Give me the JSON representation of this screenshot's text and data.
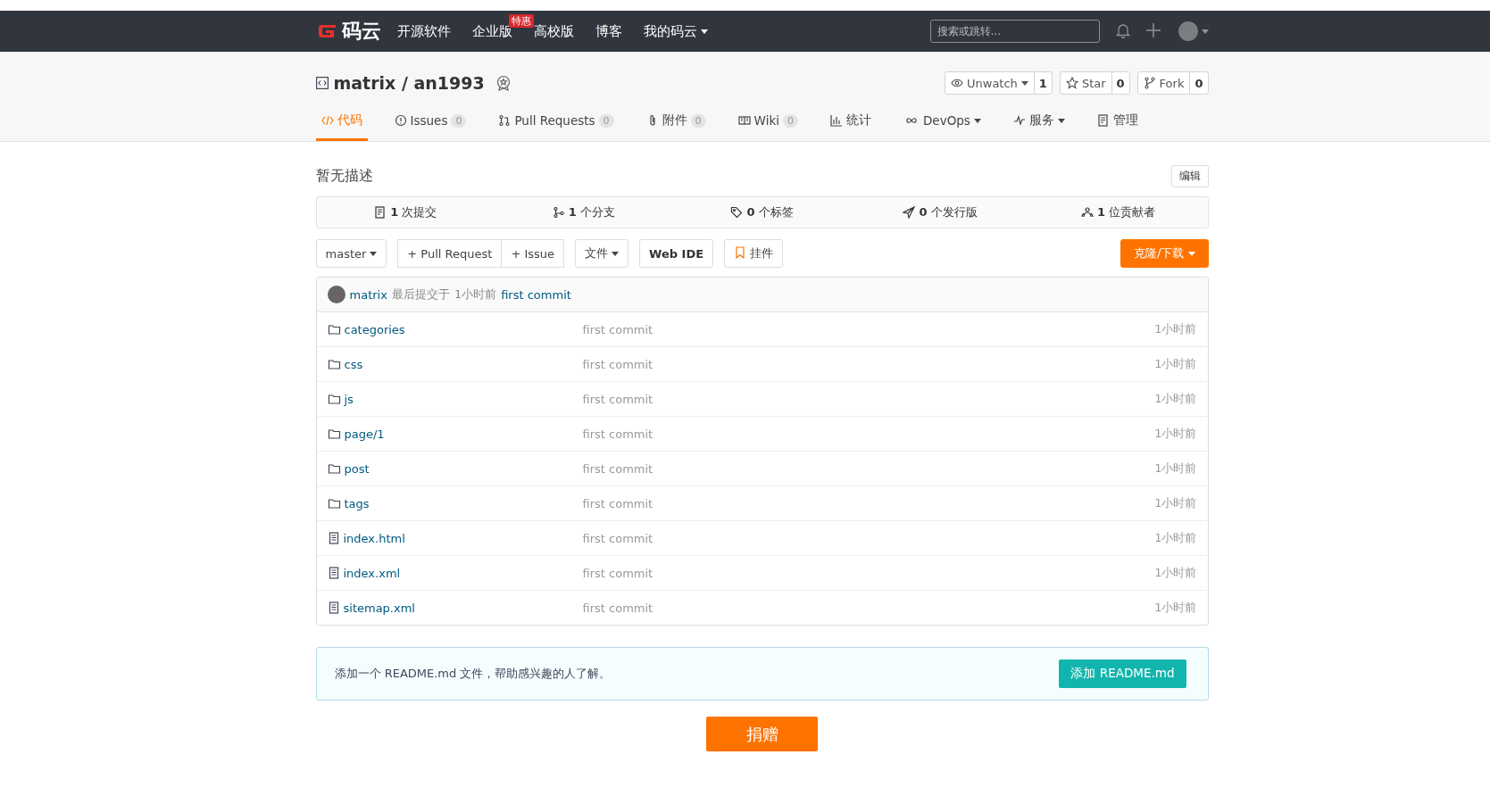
{
  "navbar": {
    "logo_text": "码云",
    "items": [
      {
        "label": "开源软件",
        "dropdown": false
      },
      {
        "label": "企业版",
        "badge": "特惠",
        "dropdown": false
      },
      {
        "label": "高校版",
        "dropdown": false
      },
      {
        "label": "博客",
        "dropdown": false
      },
      {
        "label": "我的码云",
        "dropdown": true
      }
    ],
    "search": {
      "placeholder": "搜索或跳转..."
    }
  },
  "repo": {
    "title": "matrix / an1993",
    "actions": [
      {
        "label": "Unwatch",
        "count": "1",
        "dropdown": true
      },
      {
        "label": "Star",
        "count": "0",
        "dropdown": false
      },
      {
        "label": "Fork",
        "count": "0",
        "dropdown": false
      }
    ]
  },
  "tabs": [
    {
      "label": "代码",
      "selected": true,
      "dropdown": false
    },
    {
      "label": "Issues",
      "count": "0",
      "selected": false,
      "dropdown": false
    },
    {
      "label": "Pull Requests",
      "count": "0",
      "selected": false,
      "dropdown": false
    },
    {
      "label": "附件",
      "count": "0",
      "selected": false,
      "dropdown": false
    },
    {
      "label": "Wiki",
      "count": "0",
      "selected": false,
      "dropdown": false
    },
    {
      "label": "统计",
      "selected": false,
      "dropdown": false
    },
    {
      "label": "DevOps",
      "selected": false,
      "dropdown": true
    },
    {
      "label": "服务",
      "selected": false,
      "dropdown": true
    },
    {
      "label": "管理",
      "selected": false,
      "dropdown": false
    }
  ],
  "description": "暂无描述",
  "edit_button": "编辑",
  "stats": [
    "**1** 次提交",
    "**1** 个分支",
    "**0** 个标签",
    "**0** 个发行版",
    "**1** 位贡献者"
  ],
  "toolbar": {
    "branch": "master",
    "buttons": [
      "+ Pull Request",
      "+ Issue"
    ],
    "file_menu": "文件",
    "web_ide": "Web IDE",
    "widget": "挂件",
    "clone": "克隆/下载"
  },
  "last_commit": {
    "author": "matrix",
    "text": "最后提交于",
    "time": "1小时前",
    "message": "first commit"
  },
  "files": [
    {
      "kind": "folder",
      "name": "categories",
      "message": "first commit",
      "time": "1小时前"
    },
    {
      "kind": "folder",
      "name": "css",
      "message": "first commit",
      "time": "1小时前"
    },
    {
      "kind": "folder",
      "name": "js",
      "message": "first commit",
      "time": "1小时前"
    },
    {
      "kind": "folder",
      "name": "page/1",
      "message": "first commit",
      "time": "1小时前"
    },
    {
      "kind": "folder",
      "name": "post",
      "message": "first commit",
      "time": "1小时前"
    },
    {
      "kind": "folder",
      "name": "tags",
      "message": "first commit",
      "time": "1小时前"
    },
    {
      "kind": "file",
      "name": "index.html",
      "message": "first commit",
      "time": "1小时前"
    },
    {
      "kind": "file",
      "name": "index.xml",
      "message": "first commit",
      "time": "1小时前"
    },
    {
      "kind": "file",
      "name": "sitemap.xml",
      "message": "first commit",
      "time": "1小时前"
    }
  ],
  "readme_notice": {
    "text": "添加一个 README.md 文件，帮助感兴趣的人了解。",
    "button": "添加 README.md"
  },
  "donate_button": "捐赠"
}
